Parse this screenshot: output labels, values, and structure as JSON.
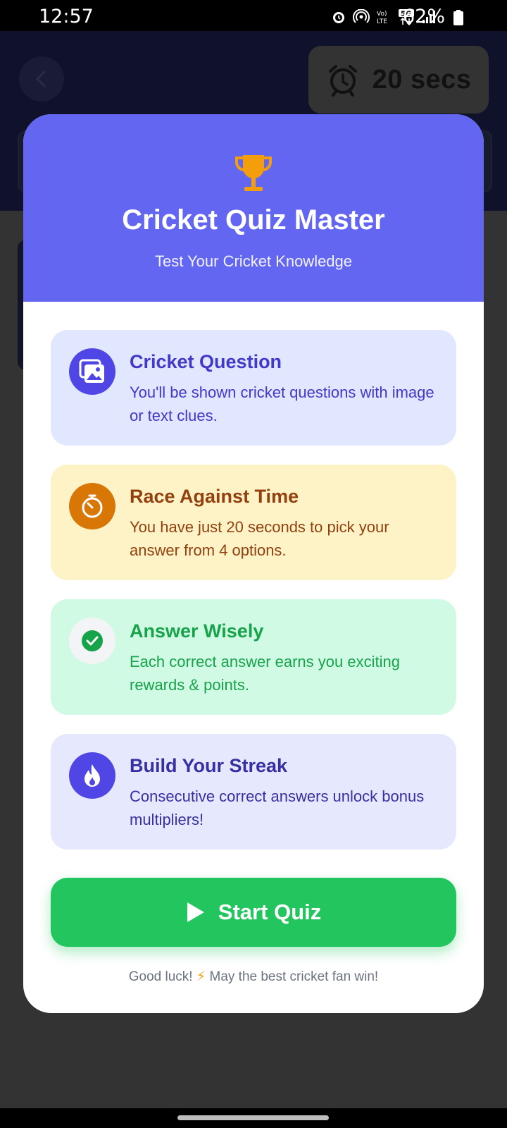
{
  "status_bar": {
    "time": "12:57",
    "battery_percent": "62%",
    "icons": [
      "alarm-icon",
      "hotspot-icon",
      "volte-icon",
      "5g-icon",
      "signal-icon",
      "battery-icon"
    ]
  },
  "background": {
    "timer_label": "20 secs",
    "back_icon": "chevron-left-icon",
    "timer_icon": "alarm-clock-icon"
  },
  "modal": {
    "title": "Cricket Quiz Master",
    "subtitle": "Test Your Cricket Knowledge",
    "header_icon": "trophy-icon",
    "cards": [
      {
        "title": "Cricket Question",
        "description": "You'll be shown cricket questions with image or text clues.",
        "icon": "image-gallery-icon"
      },
      {
        "title": "Race Against Time",
        "description": "You have just 20 seconds to pick your answer from 4 options.",
        "icon": "stopwatch-icon"
      },
      {
        "title": "Answer Wisely",
        "description": "Each correct answer earns you exciting rewards & points.",
        "icon": "check-circle-icon"
      },
      {
        "title": "Build Your Streak",
        "description": "Consecutive correct answers unlock bonus multipliers!",
        "icon": "flame-icon"
      }
    ],
    "start_button": "Start Quiz",
    "footer_prefix": "Good luck!",
    "footer_bolt": "⚡",
    "footer_suffix": "May the best cricket fan win!"
  },
  "colors": {
    "header": "#6366f1",
    "start_button": "#22c55e",
    "trophy": "#f59e0b"
  }
}
